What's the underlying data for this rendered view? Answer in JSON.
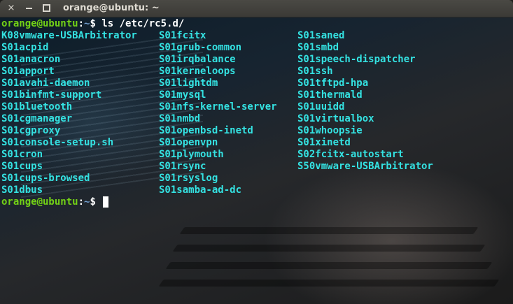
{
  "window": {
    "title": "orange@ubuntu: ~",
    "buttons": {
      "close": "×"
    }
  },
  "terminal": {
    "prompt1": {
      "user_host": "orange@ubuntu",
      "sep": ":",
      "cwd": "~",
      "symbol": "$",
      "command": " ls /etc/rc5.d/"
    },
    "columns": [
      [
        "K08vmware-USBArbitrator",
        "S01acpid",
        "S01anacron",
        "S01apport",
        "S01avahi-daemon",
        "S01binfmt-support",
        "S01bluetooth",
        "S01cgmanager",
        "S01cgproxy",
        "S01console-setup.sh",
        "S01cron",
        "S01cups",
        "S01cups-browsed",
        "S01dbus"
      ],
      [
        "S01fcitx",
        "S01grub-common",
        "S01irqbalance",
        "S01kerneloops",
        "S01lightdm",
        "S01mysql",
        "S01nfs-kernel-server",
        "S01nmbd",
        "S01openbsd-inetd",
        "S01openvpn",
        "S01plymouth",
        "S01rsync",
        "S01rsyslog",
        "S01samba-ad-dc"
      ],
      [
        "S01saned",
        "S01smbd",
        "S01speech-dispatcher",
        "S01ssh",
        "S01tftpd-hpa",
        "S01thermald",
        "S01uuidd",
        "S01virtualbox",
        "S01whoopsie",
        "S01xinetd",
        "S02fcitx-autostart",
        "S50vmware-USBArbitrator"
      ]
    ],
    "prompt2": {
      "user_host": "orange@ubuntu",
      "sep": ":",
      "cwd": "~",
      "symbol": "$",
      "command": " "
    }
  },
  "colors": {
    "user": "#73d216",
    "path": "#729fcf",
    "file": "#34e2e2",
    "text": "#ffffff"
  }
}
